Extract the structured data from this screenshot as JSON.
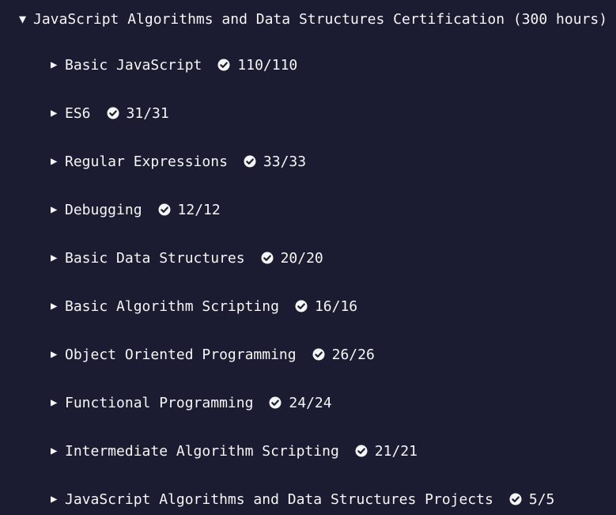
{
  "certification": {
    "title": "JavaScript Algorithms and Data Structures Certification (300 hours)",
    "caret": "▼",
    "expanded": true
  },
  "sections": [
    {
      "caret": "▶",
      "title": "Basic JavaScript",
      "progress": "110/110",
      "icon": "check-circle-icon"
    },
    {
      "caret": "▶",
      "title": "ES6",
      "progress": "31/31",
      "icon": "check-circle-icon"
    },
    {
      "caret": "▶",
      "title": "Regular Expressions",
      "progress": "33/33",
      "icon": "check-circle-icon"
    },
    {
      "caret": "▶",
      "title": "Debugging",
      "progress": "12/12",
      "icon": "check-circle-icon"
    },
    {
      "caret": "▶",
      "title": "Basic Data Structures",
      "progress": "20/20",
      "icon": "check-circle-icon"
    },
    {
      "caret": "▶",
      "title": "Basic Algorithm Scripting",
      "progress": "16/16",
      "icon": "check-circle-icon"
    },
    {
      "caret": "▶",
      "title": "Object Oriented Programming",
      "progress": "26/26",
      "icon": "check-circle-icon"
    },
    {
      "caret": "▶",
      "title": "Functional Programming",
      "progress": "24/24",
      "icon": "check-circle-icon"
    },
    {
      "caret": "▶",
      "title": "Intermediate Algorithm Scripting",
      "progress": "21/21",
      "icon": "check-circle-icon"
    },
    {
      "caret": "▶",
      "title": "JavaScript Algorithms and Data Structures Projects",
      "progress": "5/5",
      "icon": "check-circle-icon"
    }
  ],
  "colors": {
    "background": "#1b1b32",
    "text": "#f5f6f7"
  }
}
